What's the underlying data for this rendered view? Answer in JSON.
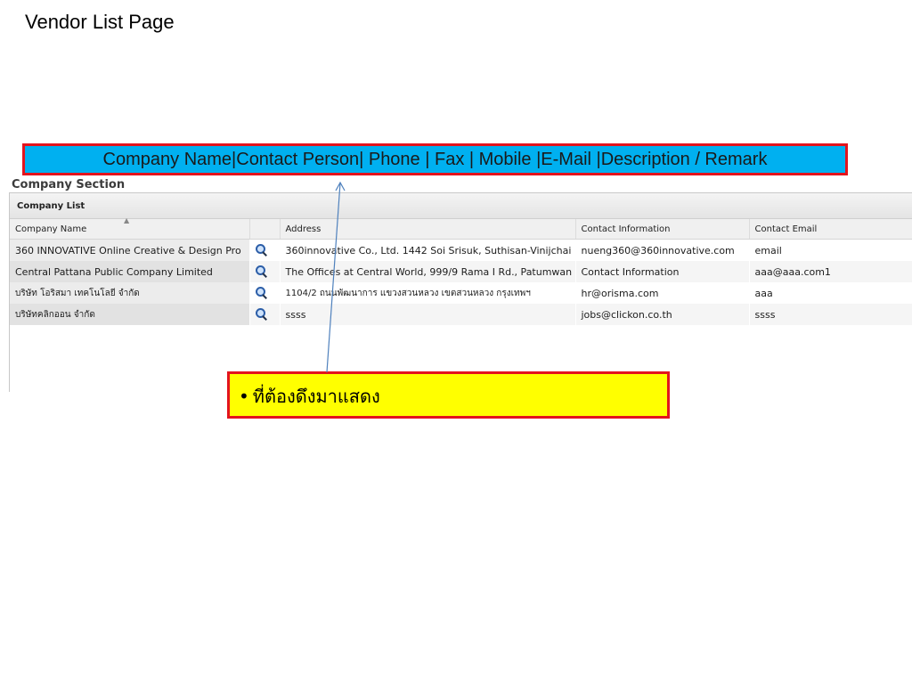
{
  "slide": {
    "title": "Vendor List Page"
  },
  "banner": {
    "text": "Company Name|Contact Person| Phone | Fax | Mobile |E-Mail |Description / Remark",
    "background": "#00b0f0",
    "border": "#e3141d"
  },
  "panel": {
    "section_title": "Company Section",
    "list_title": "Company List",
    "columns": [
      "Company Name",
      "",
      "Address",
      "Contact Information",
      "Contact Email"
    ],
    "rows": [
      {
        "company": "360 INNOVATIVE Online Creative & Design Pro",
        "icon": "magnifier-icon",
        "address": "360innovative Co., Ltd. 1442 Soi Srisuk, Suthisan-Vinijchai",
        "contact": "nueng360@360innovative.com",
        "email": "email"
      },
      {
        "company": "Central Pattana Public Company Limited",
        "icon": "magnifier-icon",
        "address": "The Offices at Central World, 999/9 Rama I Rd., Patumwan",
        "contact": "Contact Information",
        "email": "aaa@aaa.com1"
      },
      {
        "company": "บริษัท โอริสมา เทคโนโลยี จำกัด",
        "icon": "magnifier-icon",
        "address": "1104/2 ถนนพัฒนาการ แขวงสวนหลวง เขตสวนหลวง กรุงเทพฯ",
        "contact": "hr@orisma.com",
        "email": "aaa"
      },
      {
        "company": "บริษัทคลิกออน จำกัด",
        "icon": "magnifier-icon",
        "address": "ssss",
        "contact": "jobs@clickon.co.th",
        "email": "ssss"
      }
    ]
  },
  "callout": {
    "bullet": "•",
    "text": "ที่ต้องดึงมาแสดง",
    "background": "#ffff00",
    "border": "#e3141d"
  },
  "colors": {
    "arrow": "#4f81bd"
  }
}
